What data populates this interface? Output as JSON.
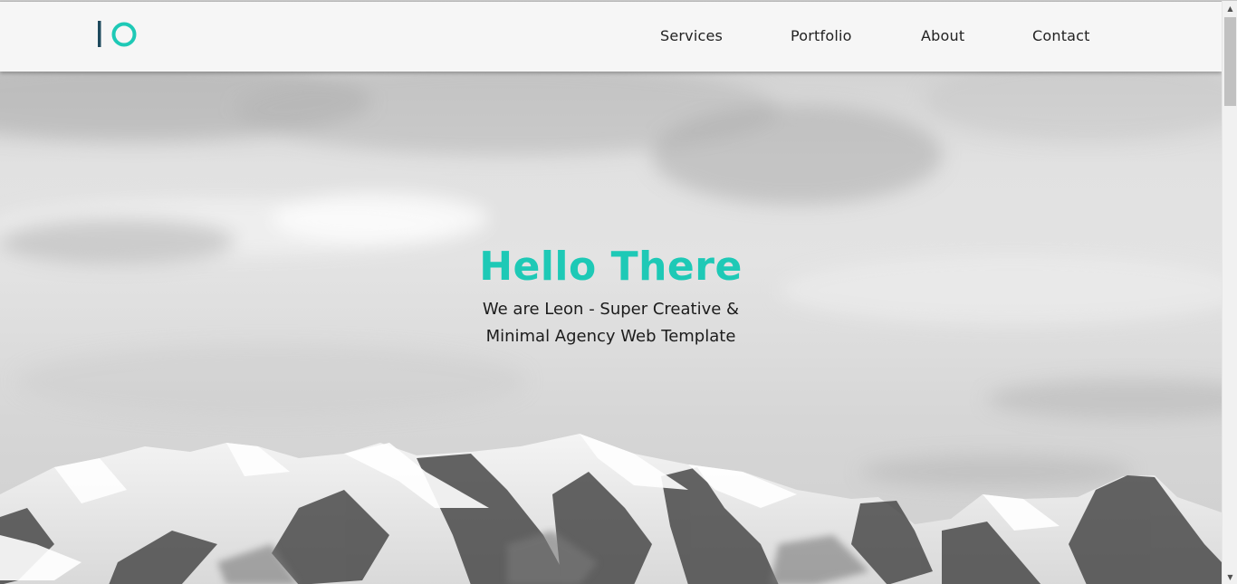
{
  "brand": {
    "logo_icon": "io-logo-icon",
    "accent_color": "#1ec9b6",
    "dark_color": "#1f4a5e"
  },
  "nav": {
    "items": [
      {
        "label": "Services"
      },
      {
        "label": "Portfolio"
      },
      {
        "label": "About"
      },
      {
        "label": "Contact"
      }
    ]
  },
  "hero": {
    "title": "Hello There",
    "subtitle_line1": "We are Leon - Super Creative &",
    "subtitle_line2": "Minimal Agency Web Template",
    "background": "snowy-mountains-grayscale-image"
  },
  "scrollbar": {
    "up_icon": "scroll-up-arrow-icon",
    "down_icon": "scroll-down-arrow-icon"
  }
}
